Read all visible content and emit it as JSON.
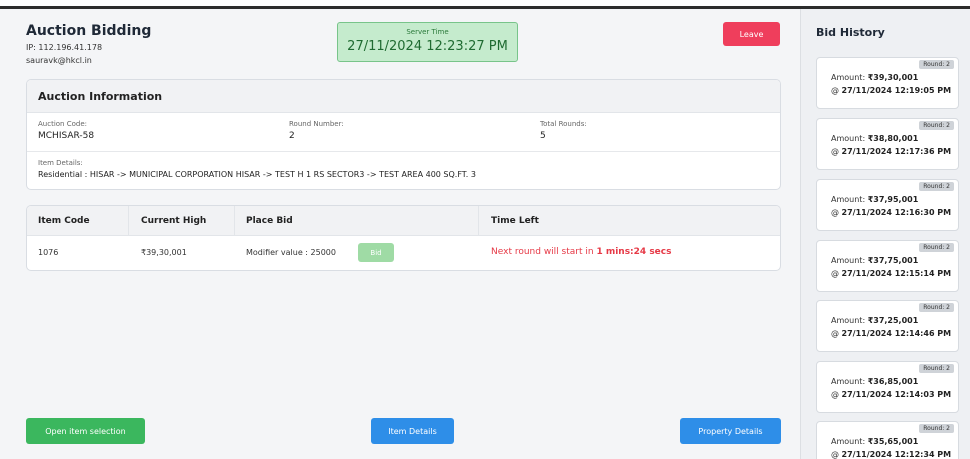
{
  "header": {
    "title": "Auction Bidding",
    "ip": "IP: 112.196.41.178",
    "email": "sauravk@hkcl.in"
  },
  "server_time": {
    "label": "Server Time",
    "value": "27/11/2024 12:23:27 PM"
  },
  "leave_label": "Leave",
  "auction_info": {
    "title": "Auction Information",
    "auction_code_label": "Auction Code:",
    "auction_code": "MCHISAR-58",
    "round_label": "Round Number:",
    "round": "2",
    "total_rounds_label": "Total Rounds:",
    "total_rounds": "5",
    "item_details_label": "Item Details:",
    "item_details": "Residential : HISAR -> MUNICIPAL CORPORATION HISAR -> TEST H 1 RS SECTOR3 -> TEST AREA 400 SQ.FT. 3"
  },
  "bid_table": {
    "headers": [
      "Item Code",
      "Current High",
      "Place Bid",
      "Time Left"
    ],
    "row": {
      "item_code": "1076",
      "current_high": "₹39,30,001",
      "modifier": "Modifier value : 25000",
      "bid_label": "Bid",
      "time_left_prefix": "Next round will start in ",
      "time_left_value": "1 mins:24 secs"
    }
  },
  "buttons": {
    "open_item_selection": "Open item selection",
    "item_details": "Item Details",
    "property_details": "Property Details"
  },
  "bid_history": {
    "title": "Bid History",
    "amount_prefix": "Amount: ",
    "at_prefix": "@ ",
    "entries": [
      {
        "round": "Round: 2",
        "amount": "₹39,30,001",
        "time": "27/11/2024 12:19:05 PM"
      },
      {
        "round": "Round: 2",
        "amount": "₹38,80,001",
        "time": "27/11/2024 12:17:36 PM"
      },
      {
        "round": "Round: 2",
        "amount": "₹37,95,001",
        "time": "27/11/2024 12:16:30 PM"
      },
      {
        "round": "Round: 2",
        "amount": "₹37,75,001",
        "time": "27/11/2024 12:15:14 PM"
      },
      {
        "round": "Round: 2",
        "amount": "₹37,25,001",
        "time": "27/11/2024 12:14:46 PM"
      },
      {
        "round": "Round: 2",
        "amount": "₹36,85,001",
        "time": "27/11/2024 12:14:03 PM"
      },
      {
        "round": "Round: 2",
        "amount": "₹35,65,001",
        "time": "27/11/2024 12:12:34 PM"
      }
    ]
  },
  "colors": {
    "leave": "#ef3e5c",
    "server_time_bg": "#c5ebcd",
    "primary_blue": "#2e8ee8",
    "success_green": "#3bb75e",
    "danger_text": "#e63946"
  }
}
